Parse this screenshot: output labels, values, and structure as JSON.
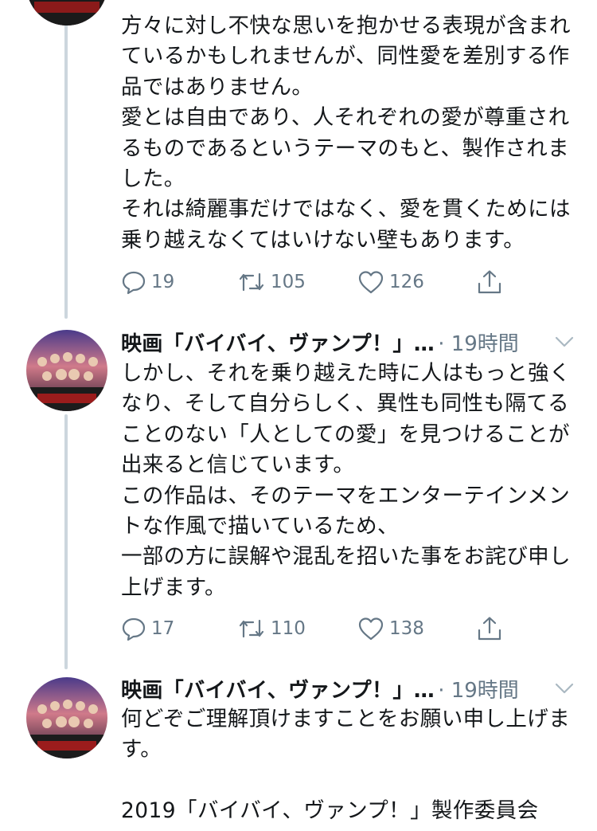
{
  "tweets": [
    {
      "text": "方々に対し不快な思いを抱かせる表現が含まれているかもしれませんが、同性愛を差別する作品ではありません。\n愛とは自由であり、人それぞれの愛が尊重されるものであるというテーマのもと、製作されました。\nそれは綺麗事だけではなく、愛を貫くためには乗り越えなくてはいけない壁もあります。",
      "replies": "19",
      "retweets": "105",
      "likes": "126"
    },
    {
      "name": "映画「バイバイ、ヴァンプ！」…",
      "time": "· 19時間",
      "text": "しかし、それを乗り越えた時に人はもっと強くなり、そして自分らしく、異性も同性も隔てることのない「人としての愛」を見つけることが出来ると信じています。\nこの作品は、そのテーマをエンターテインメントな作風で描いているため、\n一部の方に誤解や混乱を招いた事をお詫び申し上げます。",
      "replies": "17",
      "retweets": "110",
      "likes": "138"
    },
    {
      "name": "映画「バイバイ、ヴァンプ！」…",
      "time": "· 19時間",
      "text": "何どぞご理解頂けますことをお願い申し上げます。\n\n2019「バイバイ、ヴァンプ！」製作委員会"
    }
  ],
  "icons": {
    "reply": "reply-icon",
    "retweet": "retweet-icon",
    "like": "heart-icon",
    "share": "share-icon",
    "caret": "chevron-down-icon"
  },
  "colors": {
    "text": "#14171a",
    "muted": "#657786",
    "thread_line": "#ccd6dd"
  }
}
